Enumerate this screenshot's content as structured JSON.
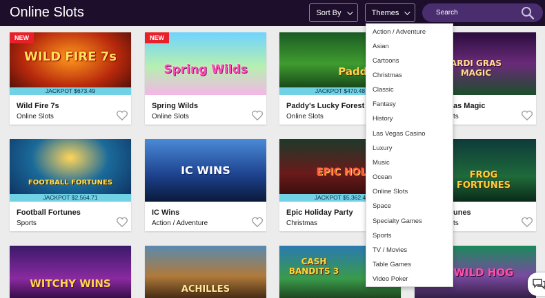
{
  "header": {
    "title": "Online Slots",
    "sort_label": "Sort By",
    "themes_label": "Themes",
    "search_placeholder": "Search"
  },
  "cards": [
    {
      "title": "Wild Fire 7s",
      "category": "Online Slots",
      "badge": "NEW",
      "jackpot": "JACKPOT $673.49",
      "art": "WILD FIRE 7s"
    },
    {
      "title": "Spring Wilds",
      "category": "Online Slots",
      "badge": "NEW",
      "art": "Spring Wilds"
    },
    {
      "title": "Paddy's Lucky Forest",
      "category": "Online Slots",
      "jackpot": "JACKPOT $470.48",
      "art": "Paddy's"
    },
    {
      "title": "as Magic",
      "category": "ts",
      "art": "ARDI GRAS MAGIC"
    },
    {
      "title": "Football Fortunes",
      "category": "Sports",
      "jackpot": "JACKPOT $2,564.71",
      "art": "FOOTBALL FORTUNES"
    },
    {
      "title": "IC Wins",
      "category": "Action / Adventure",
      "art": "IC WINS"
    },
    {
      "title": "Epic Holiday Party",
      "category": "Christmas",
      "jackpot": "JACKPOT $5,362.4",
      "art": "EPIC HOLIDAY"
    },
    {
      "title": "unes",
      "category": "ts",
      "art": "FROG FORTUNES"
    },
    {
      "art": "WITCHY WINS"
    },
    {
      "art": "ACHILLES"
    },
    {
      "art": "CASH BANDITS 3"
    },
    {
      "art": "WILD HOG"
    }
  ],
  "themes_dropdown": [
    "Action / Adventure",
    "Asian",
    "Cartoons",
    "Christmas",
    "Classic",
    "Fantasy",
    "History",
    "Las Vegas Casino",
    "Luxury",
    "Music",
    "Ocean",
    "Online Slots",
    "Space",
    "Specialty Games",
    "Sports",
    "TV / Movies",
    "Table Games",
    "Video Poker"
  ],
  "colors": {
    "header_bg": "#1d0f2c",
    "search_bg": "#4a2d6e",
    "jackpot_bg": "#71d2e6",
    "badge_bg": "#e8202a"
  }
}
